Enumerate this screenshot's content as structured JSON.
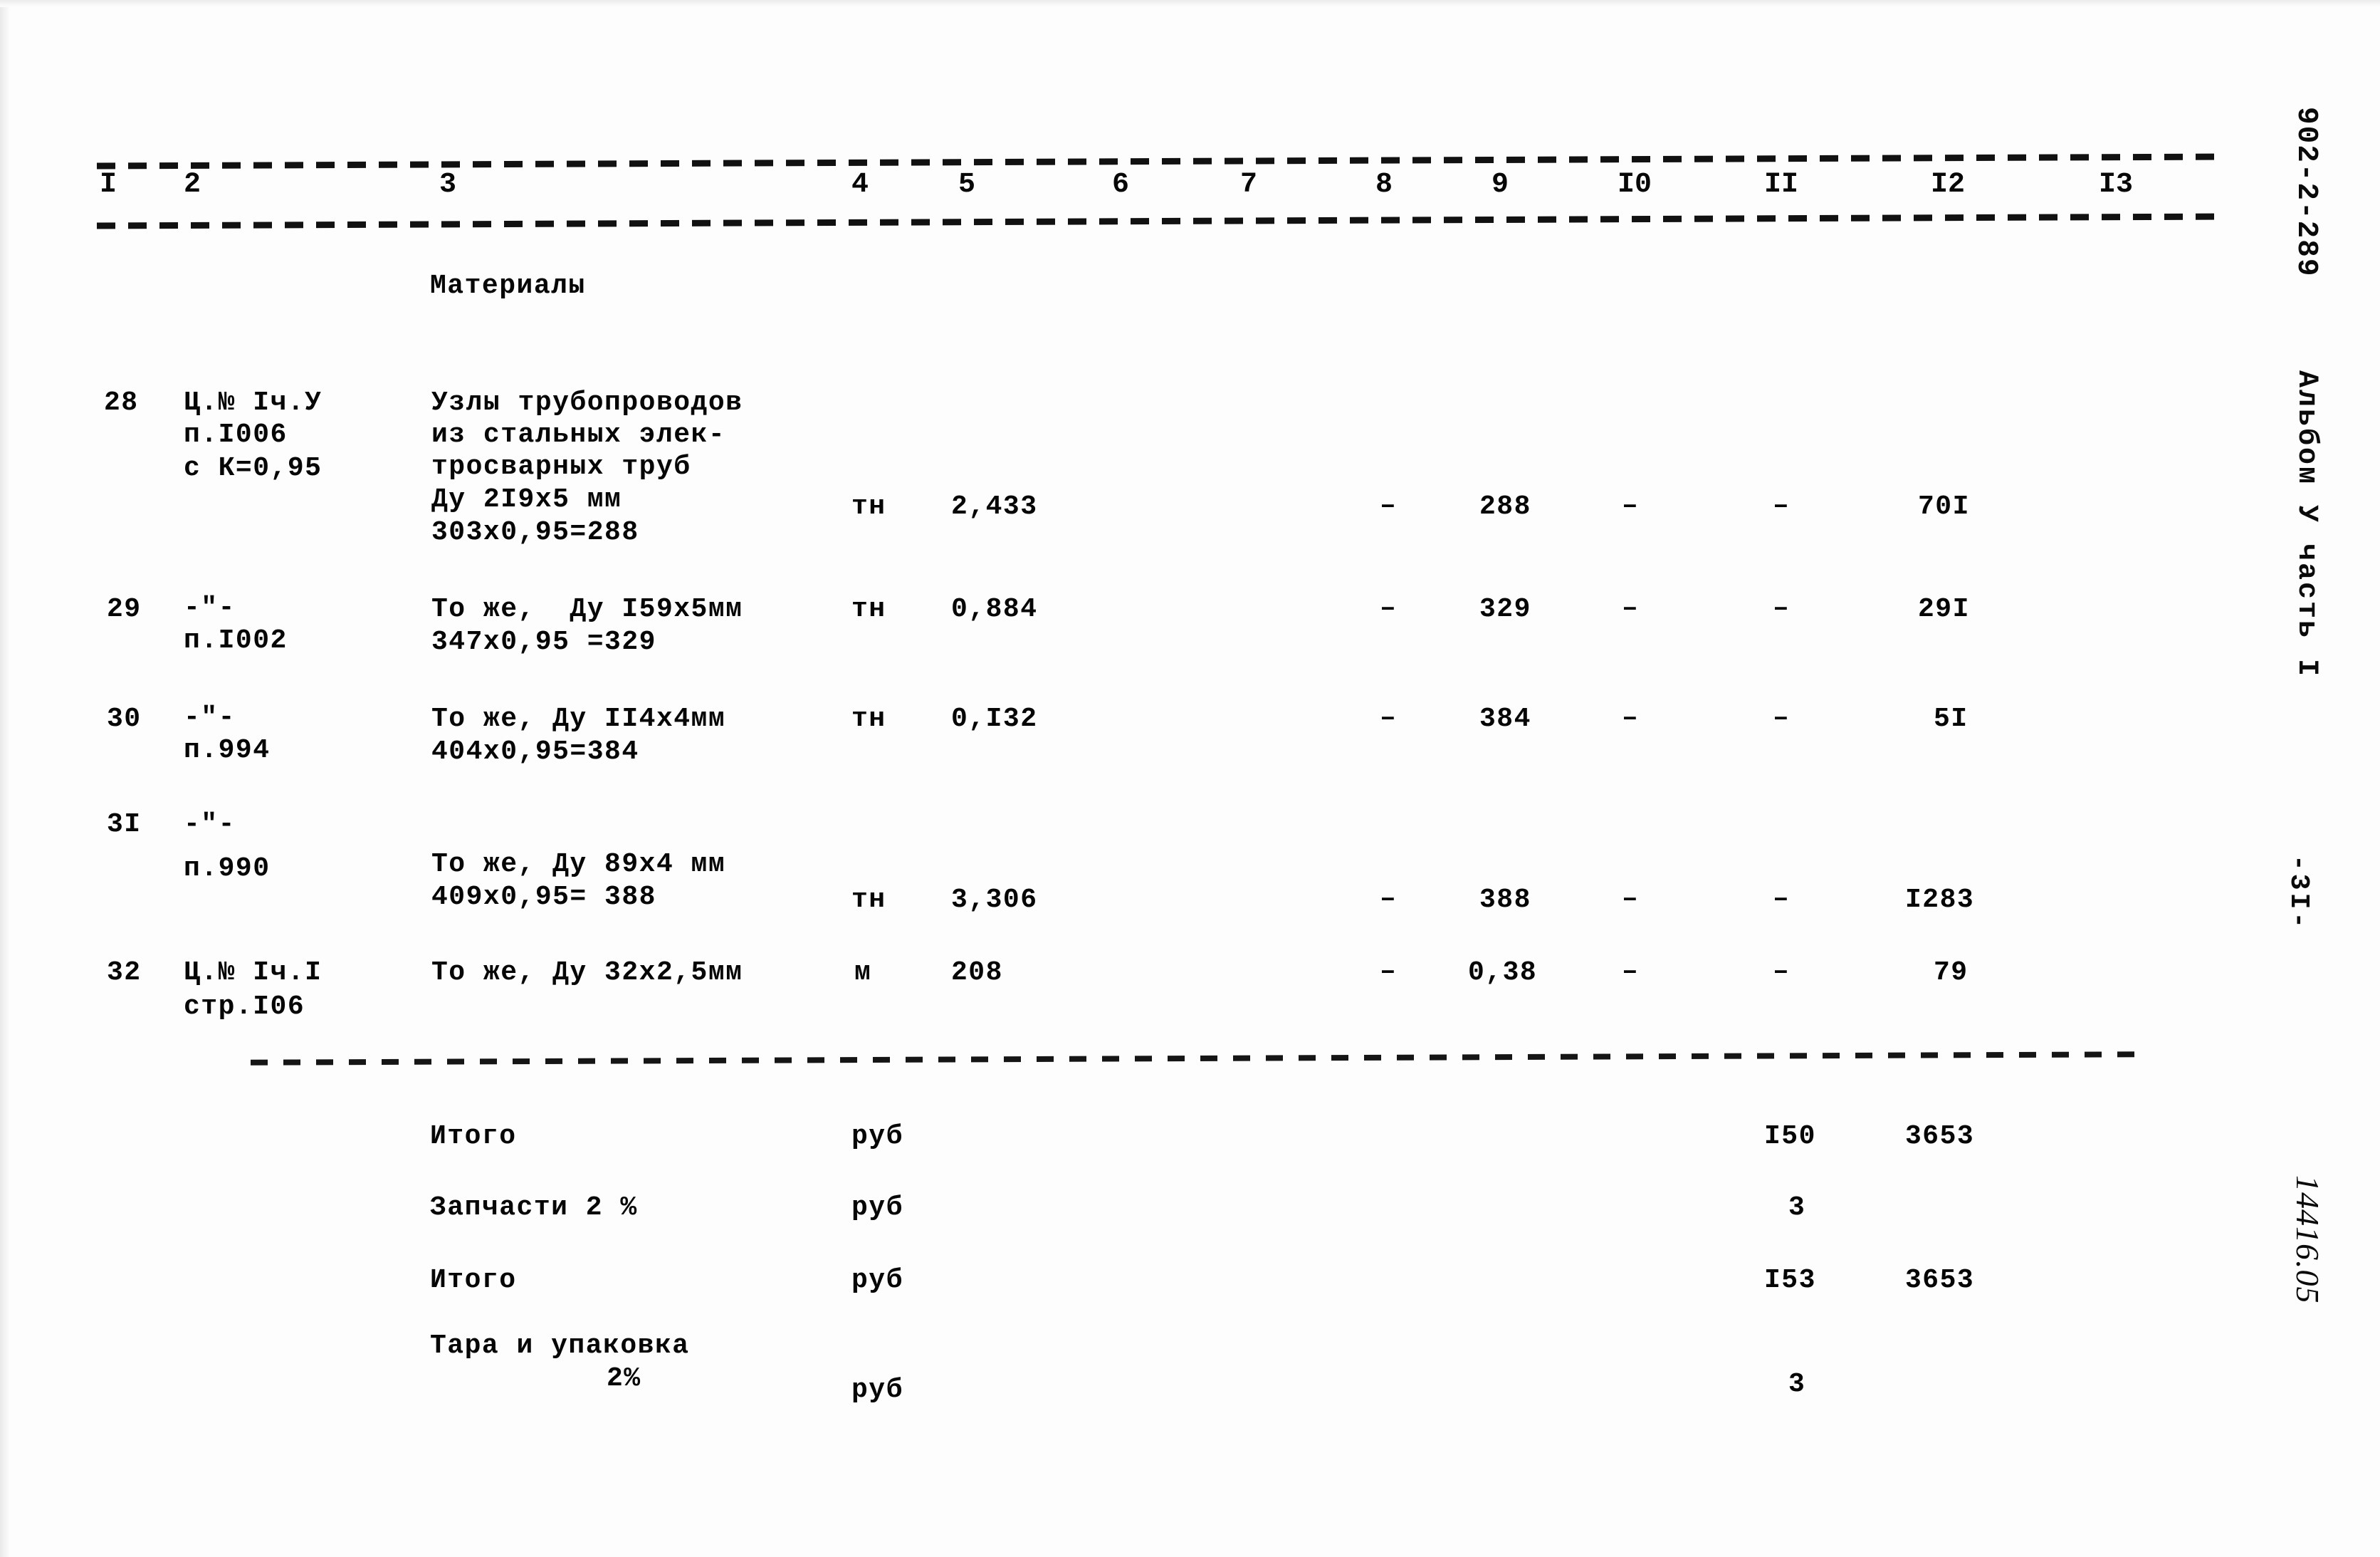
{
  "document": {
    "code": "902-2-289",
    "album": "Альбом У часть I",
    "page_label": "-3I-",
    "stamp": "14416.05"
  },
  "table": {
    "column_headers": [
      "I",
      "2",
      "3",
      "4",
      "5",
      "6",
      "7",
      "8",
      "9",
      "I0",
      "II",
      "I2",
      "I3"
    ],
    "section_heading": "Материалы",
    "rows": [
      {
        "num": "28",
        "ref": [
          "Ц.№ Iч.У",
          "п.I006",
          "с К=0,95"
        ],
        "name": [
          "Узлы трубопроводов",
          "из стальных элек-",
          "тросварных труб",
          "Ду 2I9x5 мм",
          "303x0,95=288"
        ],
        "unit": "тн",
        "qty": "2,433",
        "c6": "",
        "c7": "",
        "c8": "–",
        "c9": "288",
        "c10": "–",
        "c11": "–",
        "c12": "70I",
        "c13": ""
      },
      {
        "num": "29",
        "ref": [
          "-\"-",
          "п.I002"
        ],
        "name": [
          "То же,  Ду I59x5мм",
          "347x0,95 =329"
        ],
        "unit": "тн",
        "qty": "0,884",
        "c6": "",
        "c7": "",
        "c8": "–",
        "c9": "329",
        "c10": "–",
        "c11": "–",
        "c12": "29I",
        "c13": ""
      },
      {
        "num": "30",
        "ref": [
          "-\"-",
          "п.994"
        ],
        "name": [
          "То же, Ду II4x4мм",
          "404x0,95=384"
        ],
        "unit": "тн",
        "qty": "0,I32",
        "c6": "",
        "c7": "",
        "c8": "–",
        "c9": "384",
        "c10": "–",
        "c11": "–",
        "c12": "5I",
        "c13": ""
      },
      {
        "num": "3I",
        "ref": [
          "-\"-",
          "п.990"
        ],
        "name": [
          "То же, Ду 89x4 мм",
          "409x0,95= 388"
        ],
        "unit": "тн",
        "qty": "3,306",
        "c6": "",
        "c7": "",
        "c8": "–",
        "c9": "388",
        "c10": "–",
        "c11": "–",
        "c12": "I283",
        "c13": ""
      },
      {
        "num": "32",
        "ref": [
          "Ц.№ Iч.I",
          "стр.I06"
        ],
        "name": [
          "То же, Ду 32x2,5мм"
        ],
        "unit": "м",
        "qty": "208",
        "c6": "",
        "c7": "",
        "c8": "–",
        "c9": "0,38",
        "c10": "–",
        "c11": "–",
        "c12": "79",
        "c13": ""
      }
    ],
    "totals": [
      {
        "label": "Итого",
        "label2": "",
        "unit": "руб",
        "c11": "I50",
        "c12": "3653"
      },
      {
        "label": "Запчасти 2 %",
        "label2": "",
        "unit": "руб",
        "c11": "3",
        "c12": ""
      },
      {
        "label": "Итого",
        "label2": "",
        "unit": "руб",
        "c11": "I53",
        "c12": "3653"
      },
      {
        "label": "Тара и упаковка",
        "label2": "2%",
        "unit": "руб",
        "c11": "3",
        "c12": ""
      }
    ]
  }
}
